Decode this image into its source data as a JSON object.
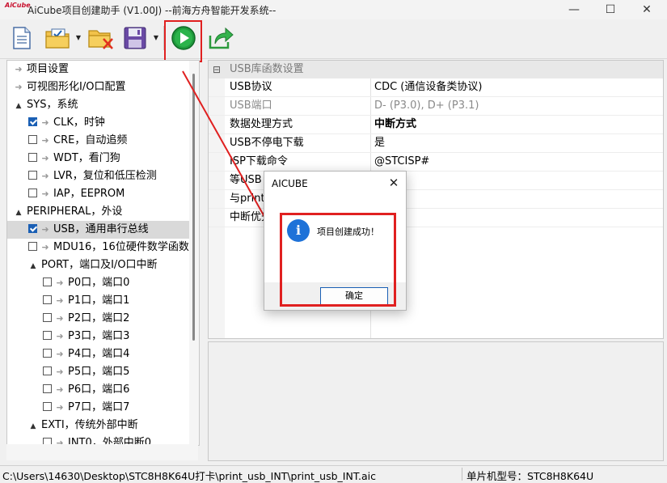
{
  "window": {
    "logo_text": "AiCube",
    "title": "AiCube项目创建助手 (V1.00J) --前海方舟智能开发系统--",
    "minimize_glyph": "—",
    "maximize_glyph": "☐",
    "close_glyph": "✕"
  },
  "toolbar": {
    "buttons": [
      {
        "name": "new-document-icon"
      },
      {
        "name": "open-folder-icon"
      },
      {
        "name": "close-folder-icon"
      },
      {
        "name": "save-disk-icon"
      },
      {
        "name": "run-play-icon"
      },
      {
        "name": "export-share-icon"
      }
    ],
    "dropdown_glyph": "▼"
  },
  "tree": {
    "bullet": "➜",
    "expand_glyph": "▲",
    "items": [
      {
        "label": "项目设置",
        "kind": "bullet",
        "indent": 0
      },
      {
        "label": "可视图形化I/O口配置",
        "kind": "bullet",
        "indent": 0
      },
      {
        "label": "SYS，系统",
        "kind": "group",
        "indent": 0
      },
      {
        "label": "CLK，时钟",
        "kind": "check",
        "checked": true,
        "indent": 1
      },
      {
        "label": "CRE，自动追频",
        "kind": "check",
        "checked": false,
        "indent": 1
      },
      {
        "label": "WDT，看门狗",
        "kind": "check",
        "checked": false,
        "indent": 1
      },
      {
        "label": "LVR，复位和低压检测",
        "kind": "check",
        "checked": false,
        "indent": 1
      },
      {
        "label": "IAP，EEPROM",
        "kind": "check",
        "checked": false,
        "indent": 1
      },
      {
        "label": "PERIPHERAL，外设",
        "kind": "group",
        "indent": 0
      },
      {
        "label": "USB，通用串行总线",
        "kind": "check",
        "checked": true,
        "indent": 1,
        "selected": true
      },
      {
        "label": "MDU16，16位硬件数学函数",
        "kind": "check",
        "checked": false,
        "indent": 1
      },
      {
        "label": "PORT，端口及I/O口中断",
        "kind": "group",
        "indent": 1
      },
      {
        "label": "P0口，端口0",
        "kind": "check",
        "checked": false,
        "indent": 2
      },
      {
        "label": "P1口，端口1",
        "kind": "check",
        "checked": false,
        "indent": 2
      },
      {
        "label": "P2口，端口2",
        "kind": "check",
        "checked": false,
        "indent": 2
      },
      {
        "label": "P3口，端口3",
        "kind": "check",
        "checked": false,
        "indent": 2
      },
      {
        "label": "P4口，端口4",
        "kind": "check",
        "checked": false,
        "indent": 2
      },
      {
        "label": "P5口，端口5",
        "kind": "check",
        "checked": false,
        "indent": 2
      },
      {
        "label": "P6口，端口6",
        "kind": "check",
        "checked": false,
        "indent": 2
      },
      {
        "label": "P7口，端口7",
        "kind": "check",
        "checked": false,
        "indent": 2
      },
      {
        "label": "EXTI，传统外部中断",
        "kind": "group",
        "indent": 1
      },
      {
        "label": "INT0，外部中断0",
        "kind": "check",
        "checked": false,
        "indent": 2
      }
    ]
  },
  "properties": {
    "header": "USB库函数设置",
    "collapse_glyph": "⊟",
    "rows": [
      {
        "key": "USB协议",
        "value": "CDC (通信设备类协议)",
        "disabled": false,
        "bold": false
      },
      {
        "key": "USB端口",
        "value": "D- (P3.0), D+ (P3.1)",
        "disabled": true,
        "bold": false
      },
      {
        "key": "数据处理方式",
        "value": "中断方式",
        "disabled": false,
        "bold": true
      },
      {
        "key": "USB不停电下载",
        "value": "是",
        "disabled": false,
        "bold": false
      },
      {
        "key": "ISP下载命令",
        "value": "@STCISP#",
        "disabled": false,
        "bold": false
      },
      {
        "key": "等USB",
        "value": "",
        "disabled": false,
        "bold": false
      },
      {
        "key": "与print",
        "value": "",
        "disabled": false,
        "bold": false
      },
      {
        "key": "中断优先",
        "value": "先级",
        "disabled": false,
        "bold": true
      }
    ]
  },
  "dialog": {
    "title": "AICUBE",
    "close_glyph": "✕",
    "icon": "i",
    "message": "项目创建成功！",
    "ok_label": "确定"
  },
  "status": {
    "path": "C:\\Users\\14630\\Desktop\\STC8H8K64U打卡\\print_usb_INT\\print_usb_INT.aic",
    "mcu": "单片机型号：STC8H8K64U"
  }
}
